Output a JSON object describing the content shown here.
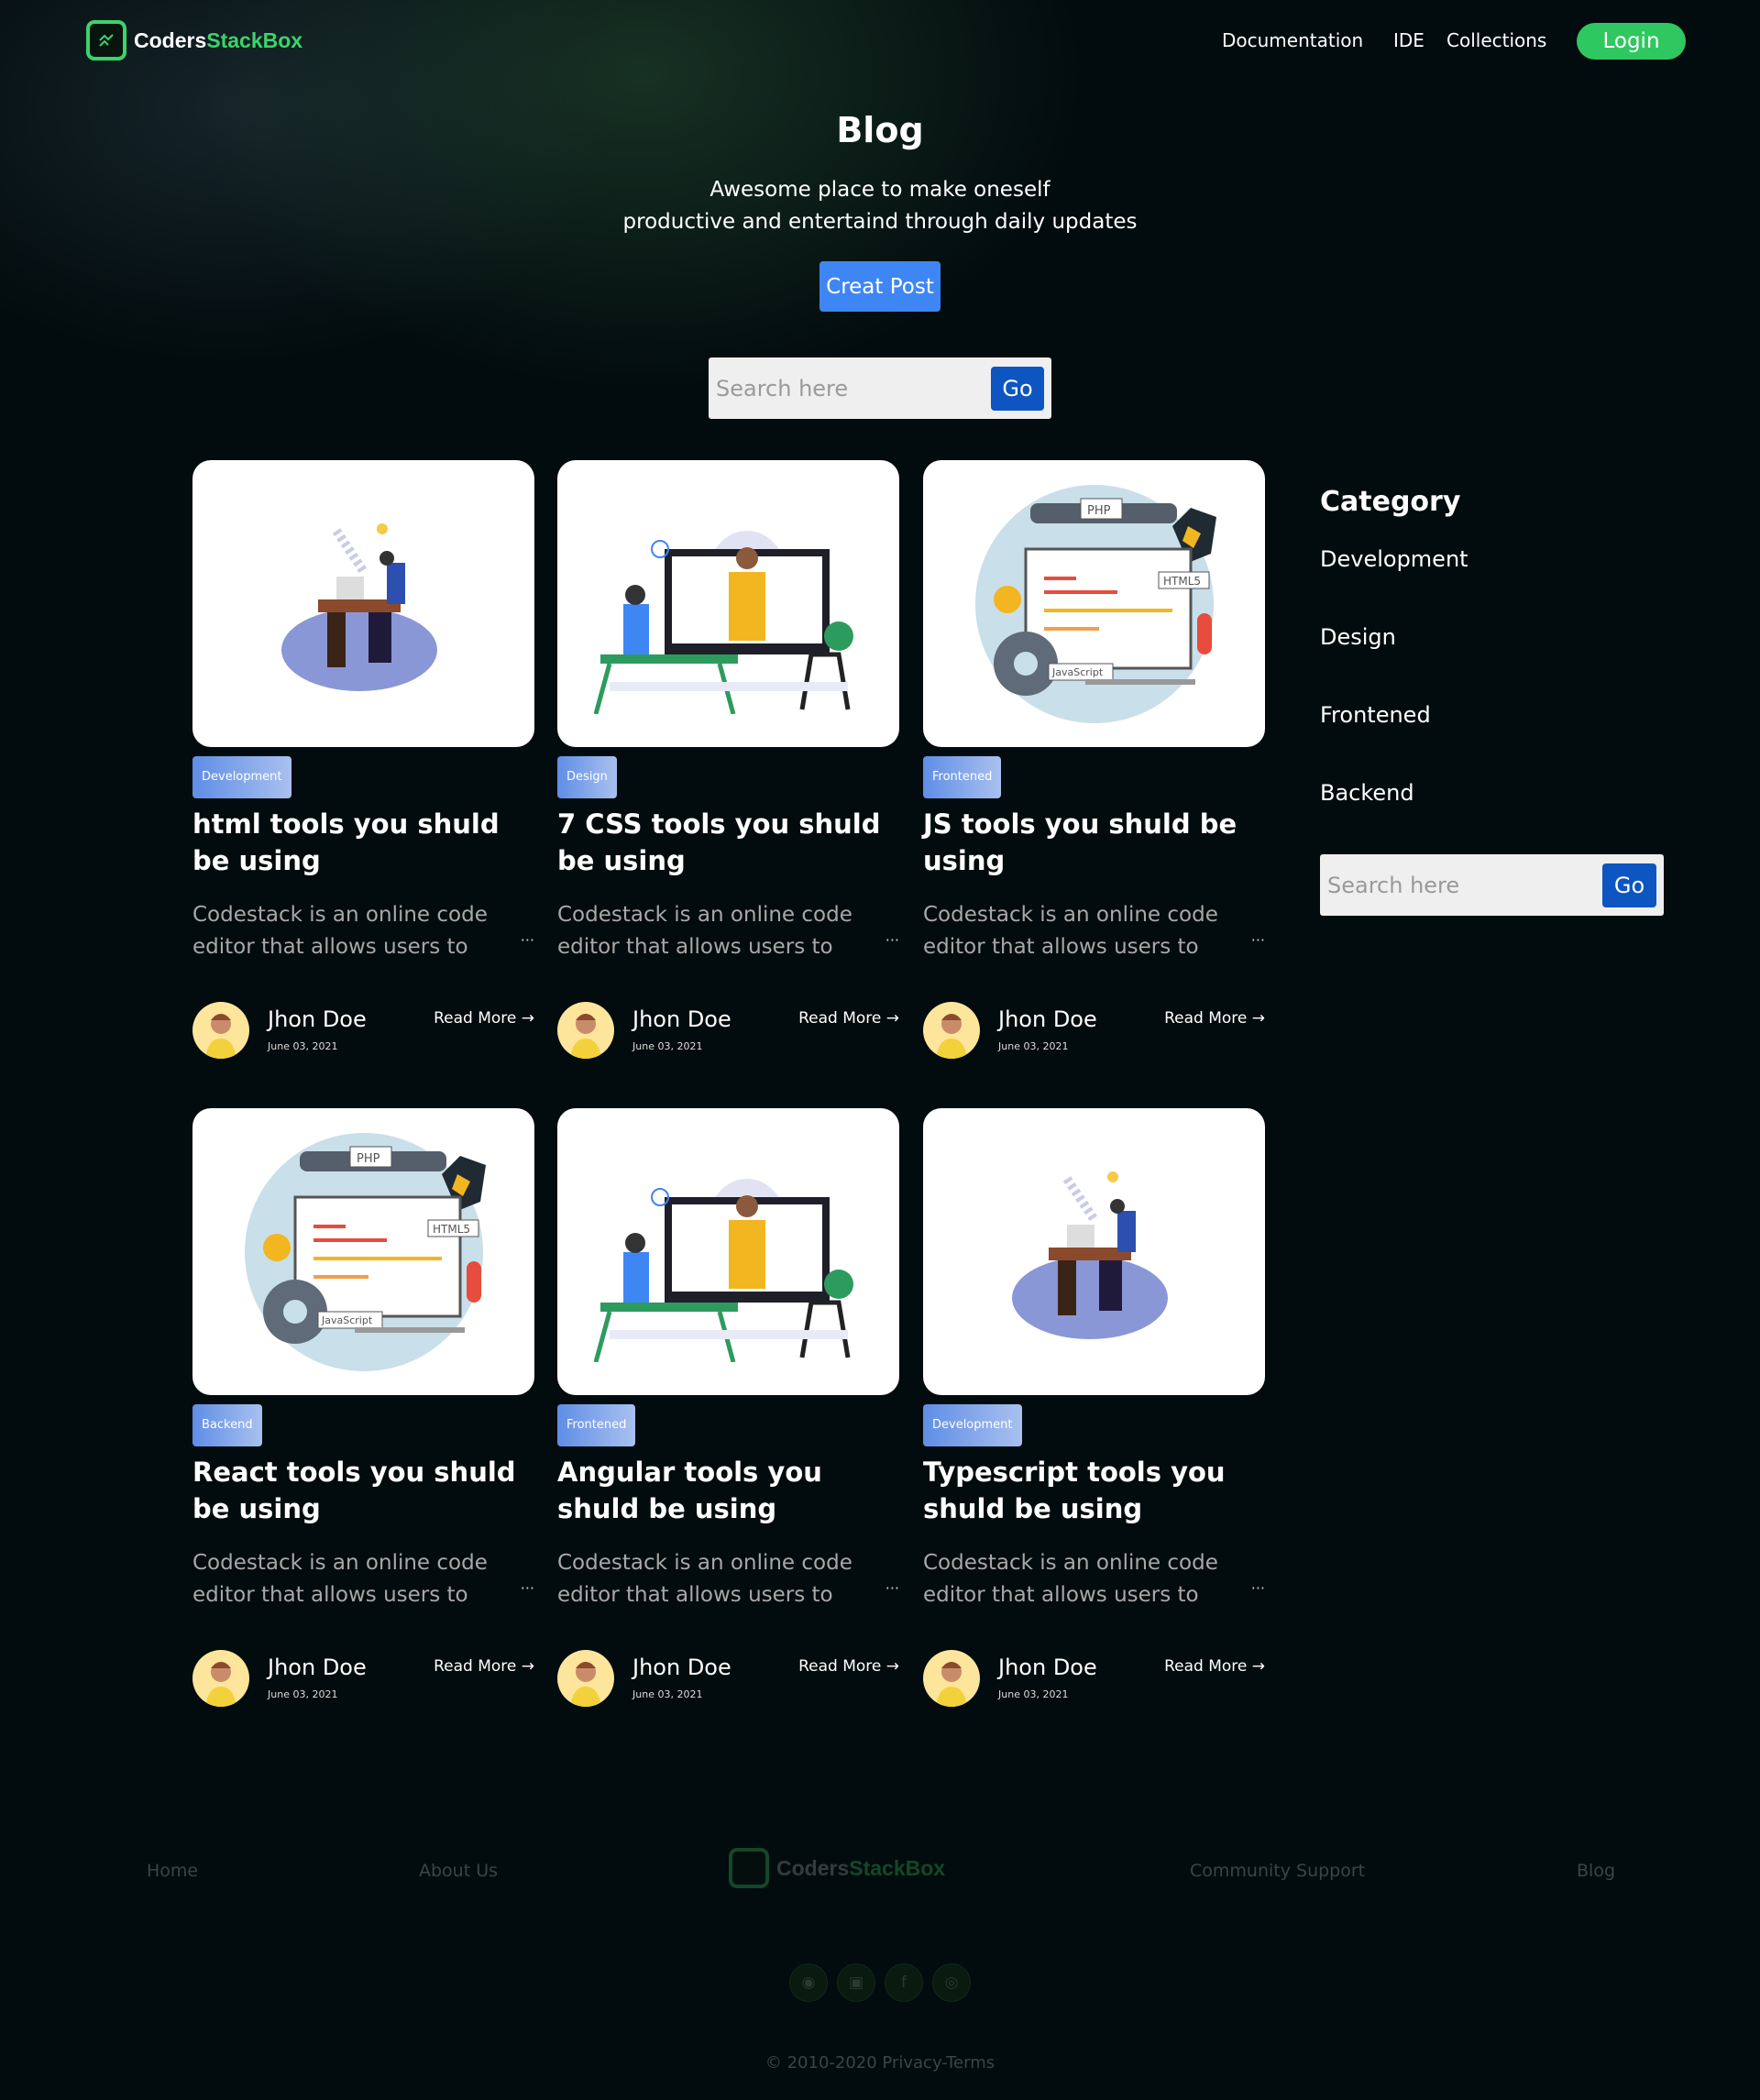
{
  "brand": {
    "name_a": "Coders",
    "name_b": "StackBox"
  },
  "nav": {
    "items": [
      "Documentation",
      "IDE",
      "Collections"
    ],
    "login": "Login"
  },
  "hero": {
    "title": "Blog",
    "subtitle_1": "Awesome place to make oneself",
    "subtitle_2": "productive and entertaind through daily updates",
    "create": "Creat Post"
  },
  "search": {
    "placeholder": "Search here",
    "go": "Go"
  },
  "posts": [
    {
      "category": "Development",
      "title": "html tools you shuld be using",
      "desc": "Codestack is an online code editor that allows users to",
      "author": "Jhon Doe",
      "date": "June 03, 2021",
      "read": "Read More",
      "art": "desk"
    },
    {
      "category": "Design",
      "title": "7 CSS tools you shuld be using",
      "desc": "Codestack is an online code editor that allows users to",
      "author": "Jhon Doe",
      "date": "June 03, 2021",
      "read": "Read More",
      "art": "meeting"
    },
    {
      "category": "Frontened",
      "title": "JS tools you shuld be using",
      "desc": "Codestack is an online code editor that allows users to",
      "author": "Jhon Doe",
      "date": "June 03, 2021",
      "read": "Read More",
      "art": "code"
    },
    {
      "category": "Backend",
      "title": "React tools you shuld be using",
      "desc": "Codestack is an online code editor that allows users to",
      "author": "Jhon Doe",
      "date": "June 03, 2021",
      "read": "Read More",
      "art": "code"
    },
    {
      "category": "Frontened",
      "title": "Angular tools you shuld be using",
      "desc": "Codestack is an online code editor that allows users to",
      "author": "Jhon Doe",
      "date": "June 03, 2021",
      "read": "Read More",
      "art": "meeting"
    },
    {
      "category": "Development",
      "title": "Typescript tools you shuld be using",
      "desc": "Codestack is an online code editor that allows users to",
      "author": "Jhon Doe",
      "date": "June 03, 2021",
      "read": "Read More",
      "art": "desk"
    }
  ],
  "art_labels": {
    "php": "PHP",
    "html5": "HTML5",
    "js": "JavaScript"
  },
  "sidebar": {
    "title": "Category",
    "items": [
      "Development",
      "Design",
      "Frontened",
      "Backend"
    ],
    "search_placeholder": "Search here",
    "go": "Go"
  },
  "footer": {
    "links": [
      "Home",
      "About Us",
      "Community Support",
      "Blog"
    ],
    "social": [
      "github-icon",
      "linkedin-icon",
      "facebook-icon",
      "dribbble-icon"
    ],
    "copyright": "2010-2020 Privacy-Terms"
  },
  "colors": {
    "accent_green": "#3dd36b",
    "button_blue": "#3f86f5",
    "go_blue": "#0d55c1"
  }
}
